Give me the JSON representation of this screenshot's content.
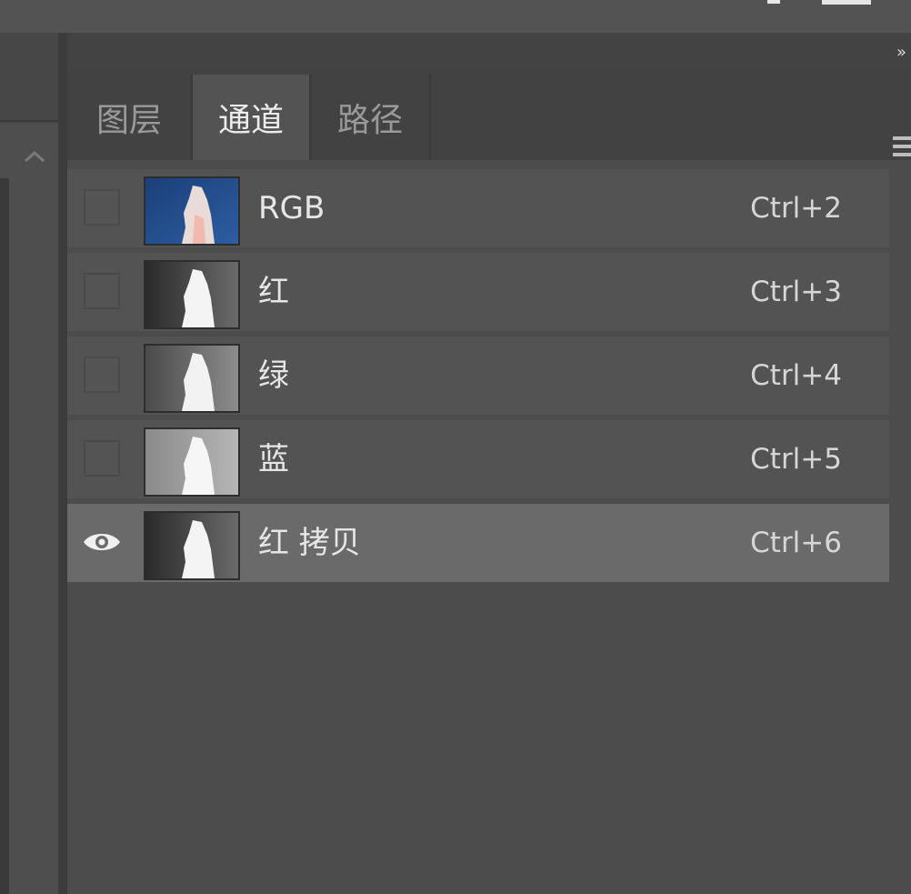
{
  "panel": {
    "tabs": [
      {
        "label": "图层",
        "active": false
      },
      {
        "label": "通道",
        "active": true
      },
      {
        "label": "路径",
        "active": false
      }
    ],
    "channels": [
      {
        "name": "RGB",
        "shortcut": "Ctrl+2",
        "visible": false,
        "selected": false,
        "thumb_icon": "rgb-thumbnail"
      },
      {
        "name": "红",
        "shortcut": "Ctrl+3",
        "visible": false,
        "selected": false,
        "thumb_icon": "red-channel-thumbnail"
      },
      {
        "name": "绿",
        "shortcut": "Ctrl+4",
        "visible": false,
        "selected": false,
        "thumb_icon": "green-channel-thumbnail"
      },
      {
        "name": "蓝",
        "shortcut": "Ctrl+5",
        "visible": false,
        "selected": false,
        "thumb_icon": "blue-channel-thumbnail"
      },
      {
        "name": "红 拷贝",
        "shortcut": "Ctrl+6",
        "visible": true,
        "selected": true,
        "thumb_icon": "red-copy-channel-thumbnail"
      }
    ]
  },
  "colors": {
    "background": "#474747",
    "panel": "#4c4c4c",
    "row": "#535353",
    "row_selected": "#6a6a6a",
    "rgb_thumb_accent": "#1f4a8a"
  }
}
